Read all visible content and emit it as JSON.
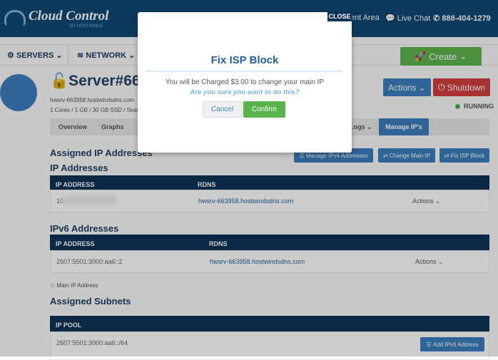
{
  "header": {
    "logo": "Cloud Control",
    "logo_sub": "BY HOSTWINDS",
    "client_area": "Client Area",
    "live_chat": "Live Chat",
    "phone": "888-404-1279"
  },
  "nav": {
    "servers": "SERVERS",
    "network": "NETWORK",
    "create": "Create"
  },
  "server": {
    "title": "Server#663958",
    "hostname": "hwsrv-663958.hostwindsdns.com",
    "specs": "1 Cores / 1 GB / 30 GB SSD / Seattle",
    "actions": "Actions",
    "shutdown": "Shutdown",
    "status": "RUNNING",
    "status_color": "#4caf50"
  },
  "tabs": [
    {
      "label": "Overview"
    },
    {
      "label": "Graphs"
    },
    {
      "label": "Logs"
    },
    {
      "label": "Manage IP's"
    }
  ],
  "assigned": {
    "title": "Assigned IP Addresses",
    "manage_ipv4": "Manage IPv4 Addresses",
    "change_main": "Change Main IP",
    "fix_isp": "Fix ISP Block"
  },
  "ipv4": {
    "title": "IP Addresses",
    "col_ip": "IP ADDRESS",
    "col_rdns": "RDNS",
    "rows": [
      {
        "ip": "10",
        "rdns": "hwsrv-663958.hostwindsdns.com",
        "actions": "Actions"
      }
    ]
  },
  "ipv6": {
    "title": "IPv6 Addresses",
    "col_ip": "IP ADDRESS",
    "col_rdns": "RDNS",
    "rows": [
      {
        "ip": "2607:5501:3000:aa6::2",
        "rdns": "hwsrv-663958.hostwindsdns.com",
        "actions": "Actions"
      }
    ]
  },
  "legend": "Main IP Address",
  "subnets": {
    "title": "Assigned Subnets",
    "col_pool": "IP POOL",
    "rows": [
      {
        "pool": "2607:5501:3000:aa6::/64"
      }
    ],
    "add_ipv6": "Add IPv6 Address"
  },
  "modal": {
    "close": "CLOSE",
    "title": "Fix ISP Block",
    "message": "You will be Charged $3.00 to change your main IP",
    "confirm_q": "Are you sure you want to do this?",
    "cancel": "Cancel",
    "confirm": "Confirm"
  }
}
